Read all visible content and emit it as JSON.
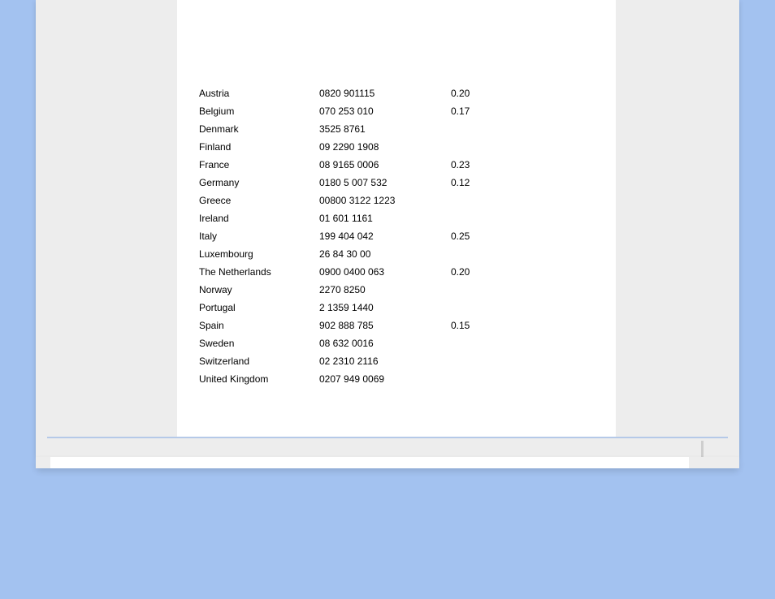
{
  "table": {
    "rows": [
      {
        "country": "Austria",
        "phone": "0820 901115",
        "rate": "0.20"
      },
      {
        "country": "Belgium",
        "phone": "070 253 010",
        "rate": "0.17"
      },
      {
        "country": "Denmark",
        "phone": "3525 8761",
        "rate": ""
      },
      {
        "country": "Finland",
        "phone": "09 2290 1908",
        "rate": ""
      },
      {
        "country": "France",
        "phone": "08 9165 0006",
        "rate": "0.23"
      },
      {
        "country": "Germany",
        "phone": "0180 5 007 532",
        "rate": "0.12"
      },
      {
        "country": "Greece",
        "phone": "00800 3122 1223",
        "rate": ""
      },
      {
        "country": "Ireland",
        "phone": "01 601 1161",
        "rate": ""
      },
      {
        "country": "Italy",
        "phone": "199 404 042",
        "rate": "0.25"
      },
      {
        "country": "Luxembourg",
        "phone": "26 84 30 00",
        "rate": ""
      },
      {
        "country": "The Netherlands",
        "phone": "0900 0400 063",
        "rate": "0.20"
      },
      {
        "country": "Norway",
        "phone": "2270 8250",
        "rate": ""
      },
      {
        "country": "Portugal",
        "phone": "2 1359 1440",
        "rate": ""
      },
      {
        "country": "Spain",
        "phone": "902 888 785",
        "rate": "0.15"
      },
      {
        "country": "Sweden",
        "phone": "08 632 0016",
        "rate": ""
      },
      {
        "country": "Switzerland",
        "phone": "02 2310 2116",
        "rate": ""
      },
      {
        "country": "United Kingdom",
        "phone": "0207 949 0069",
        "rate": ""
      }
    ]
  }
}
